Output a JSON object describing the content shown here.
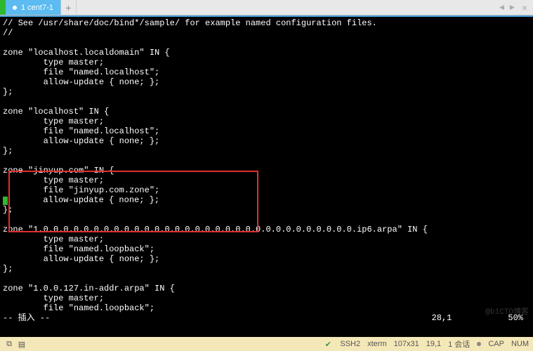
{
  "tab": {
    "label": "1 cent7-1"
  },
  "terminal": {
    "lines": [
      "// See /usr/share/doc/bind*/sample/ for example named configuration files.",
      "//",
      "",
      "zone \"localhost.localdomain\" IN {",
      "        type master;",
      "        file \"named.localhost\";",
      "        allow-update { none; };",
      "};",
      "",
      "zone \"localhost\" IN {",
      "        type master;",
      "        file \"named.localhost\";",
      "        allow-update { none; };",
      "};",
      "",
      "zone \"jinyup.com\" IN {",
      "        type master;",
      "        file \"jinyup.com.zone\";",
      "        allow-update { none; };",
      "};",
      "",
      "zone \"1.0.0.0.0.0.0.0.0.0.0.0.0.0.0.0.0.0.0.0.0.0.0.0.0.0.0.0.0.0.0.0.ip6.arpa\" IN {",
      "        type master;",
      "        file \"named.loopback\";",
      "        allow-update { none; };",
      "};",
      "",
      "zone \"1.0.0.127.in-addr.arpa\" IN {",
      "        type master;",
      "        file \"named.loopback\";"
    ],
    "cursor_line_index": 18,
    "vim_mode": "-- 插入 --",
    "vim_position": "28,1",
    "vim_percent": "50%"
  },
  "statusbar": {
    "ssh": "SSH2",
    "term": "xterm",
    "size": "107x31",
    "rows": "19,1",
    "sessions": "1 会话",
    "cap": "CAP",
    "num": "NUM"
  },
  "watermark": "@b1CTO博客"
}
